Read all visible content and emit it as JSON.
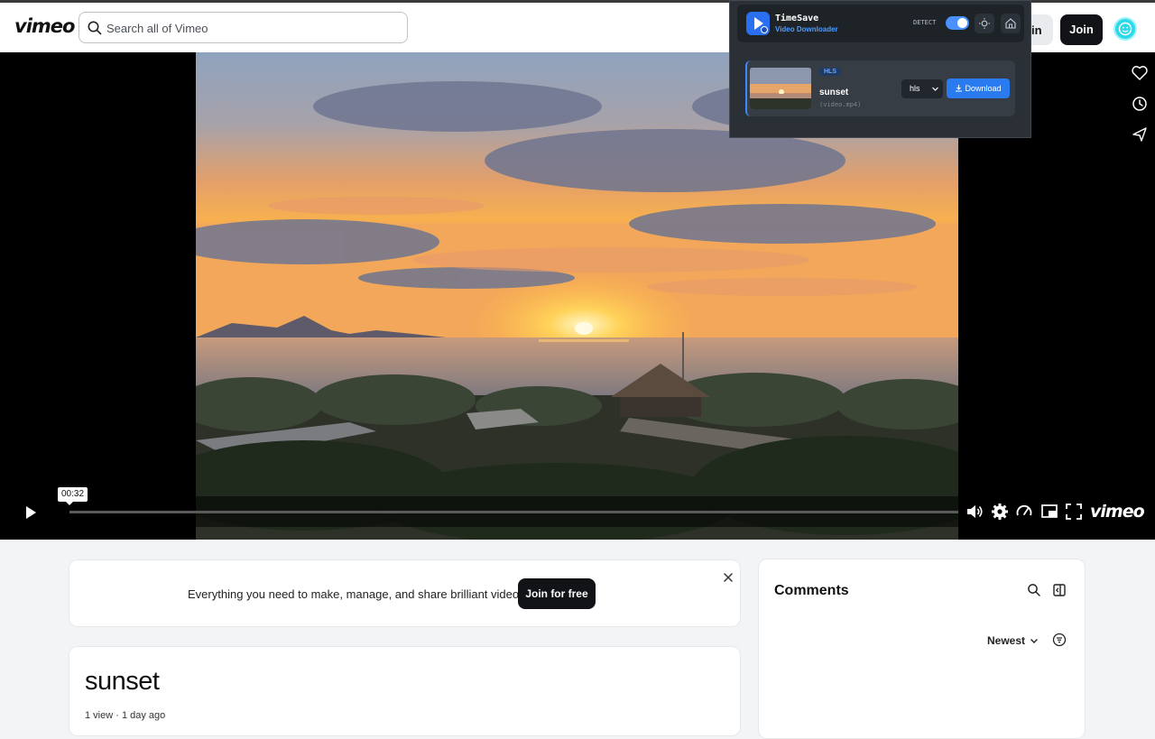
{
  "header": {
    "logo": "vimeo",
    "search_placeholder": "Search all of Vimeo",
    "login_label": "in",
    "join_label": "Join"
  },
  "player": {
    "current_time": "00:32",
    "progress": 0.0,
    "brand": "vimeo",
    "side_actions": [
      "like-icon",
      "watch-later-icon",
      "share-icon"
    ],
    "controls": [
      "volume-icon",
      "settings-icon",
      "speed-icon",
      "pip-icon",
      "fullscreen-icon"
    ]
  },
  "extension": {
    "name": "TimeSave",
    "subtitle": "Video Downloader",
    "detect_label": "DETECT",
    "detect_on": true,
    "item": {
      "badge": "HLS",
      "title": "sunset",
      "filename": "(video.mp4)",
      "format": "hls",
      "download_label": "Download"
    },
    "accent": "#2a7bf0"
  },
  "promo": {
    "text": "Everything you need to make, manage, and share brilliant videos.",
    "cta": "Join for free"
  },
  "video": {
    "title": "sunset",
    "views": "1 view",
    "age": "1 day ago"
  },
  "comments": {
    "title": "Comments",
    "sort_label": "Newest"
  }
}
